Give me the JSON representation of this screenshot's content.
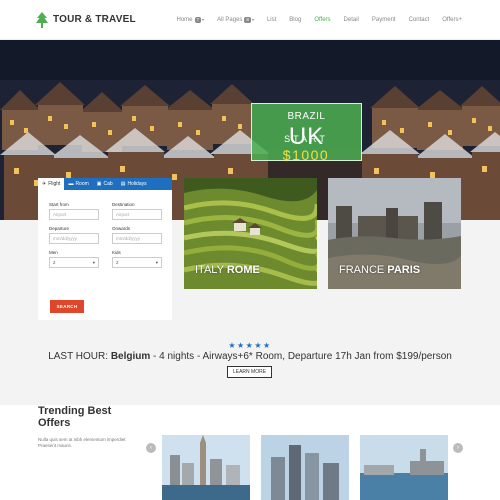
{
  "header": {
    "logo_text": "TOUR & TRAVEL",
    "nav": [
      {
        "label": "Home",
        "badge": "7",
        "caret": "▾"
      },
      {
        "label": "All Pages",
        "badge": "8",
        "caret": "▾"
      },
      {
        "label": "List"
      },
      {
        "label": "Blog"
      },
      {
        "label": "Offers",
        "active": true
      },
      {
        "label": "Detail"
      },
      {
        "label": "Payment"
      },
      {
        "label": "Contact"
      },
      {
        "label": "Offers+"
      }
    ]
  },
  "hero": {
    "promo_small": "BRAZIL",
    "promo_big": "UK",
    "start_label": "START",
    "price": "$1000"
  },
  "booking": {
    "tabs": [
      {
        "label": "Flight",
        "icon": "plane-icon",
        "glyph": "✈",
        "active": true
      },
      {
        "label": "Room",
        "icon": "bed-icon",
        "glyph": "▬"
      },
      {
        "label": "Cab",
        "icon": "car-icon",
        "glyph": "▣"
      },
      {
        "label": "Holidays",
        "icon": "bag-icon",
        "glyph": "▤"
      }
    ],
    "start_from": {
      "label": "Start from",
      "placeholder": "Airport"
    },
    "destination": {
      "label": "Destination",
      "placeholder": "Airport"
    },
    "departure": {
      "label": "Departure",
      "placeholder": "mm/dd/yyyy"
    },
    "onwards": {
      "label": "Onwards",
      "placeholder": "mm/dd/yyyy"
    },
    "men": {
      "label": "Men",
      "value": "2"
    },
    "kids": {
      "label": "Kids",
      "value": "2"
    },
    "search_label": "SEARCH"
  },
  "cards": [
    {
      "country": "ITALY",
      "city": "ROME"
    },
    {
      "country": "FRANCE",
      "city": "PARIS"
    }
  ],
  "last_hour": {
    "stars": "★★★★★",
    "prefix": "LAST HOUR:",
    "destination": "Belgium",
    "details": "- 4 nights - Airways+6* Room, Departure 17h Jan from $199/person",
    "button_label": "LEARN MORE"
  },
  "trending": {
    "title_line1": "Trending Best",
    "title_line2": "Offers",
    "description": "Nulla quis sem at nibh elementum imperdiet Praesent mauris.",
    "prev_glyph": "‹",
    "next_glyph": "›"
  },
  "colors": {
    "accent_green": "#4caf50",
    "tab_blue": "#1e6fc0",
    "search_red": "#e0462a",
    "price_yellow": "#f0e040"
  }
}
